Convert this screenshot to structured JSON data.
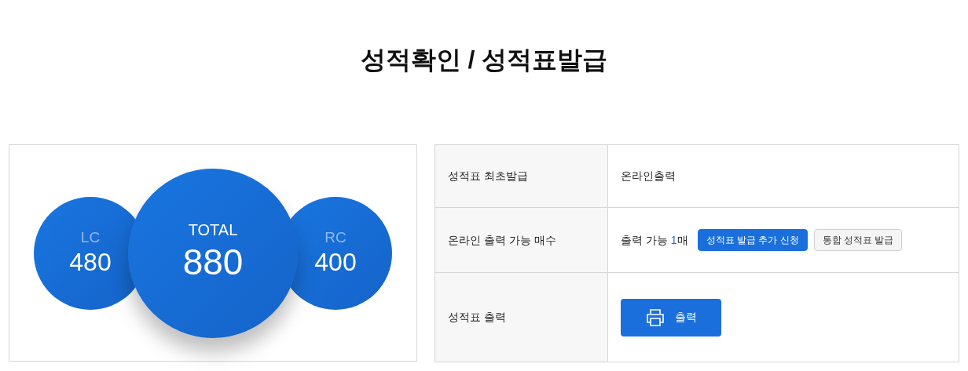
{
  "title": "성적확인 / 성적표발급",
  "scores": [
    {
      "kind": "side",
      "label": "LC",
      "value": "480"
    },
    {
      "kind": "total",
      "label": "TOTAL",
      "value": "880"
    },
    {
      "kind": "side",
      "label": "RC",
      "value": "400"
    }
  ],
  "rows": [
    {
      "kind": "text",
      "label": "성적표 최초발급",
      "text": "온라인출력"
    },
    {
      "kind": "count",
      "label": "온라인 출력 가능 매수",
      "prefix": "출력 가능 ",
      "count": "1",
      "unit": "매",
      "buttons": [
        {
          "label": "성적표 발급 추가 신청",
          "primary": true
        },
        {
          "label": "통합 성적표 발급",
          "primary": false
        }
      ]
    },
    {
      "kind": "print",
      "label": "성적표 출력",
      "button": "출력"
    }
  ]
}
